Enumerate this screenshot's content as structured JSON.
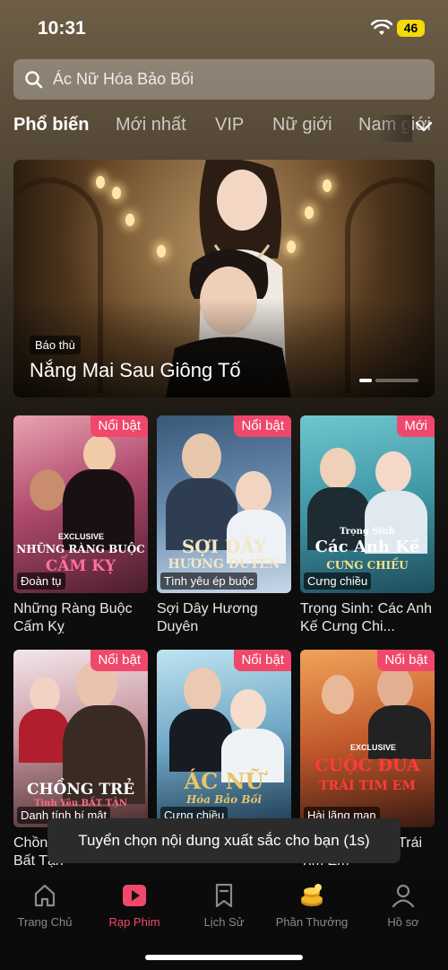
{
  "status": {
    "time": "10:31",
    "battery": "46"
  },
  "search": {
    "placeholder": "Ác Nữ Hóa Bảo Bối"
  },
  "tabs": [
    {
      "label": "Phổ biến",
      "active": true
    },
    {
      "label": "Mới nhất"
    },
    {
      "label": "VIP"
    },
    {
      "label": "Nữ giới"
    },
    {
      "label": "Nam giới"
    }
  ],
  "hero": {
    "tag": "Báo thù",
    "title": "Nắng Mai Sau Giông Tố"
  },
  "cards": [
    {
      "badge": "Nổi bật",
      "genre": "Đoàn tụ",
      "title": "Những Ràng Buộc Cấm Kỵ",
      "art_top": "EXCLUSIVE",
      "art_title": "NHỮNG RÀNG BUỘC",
      "art_sub": "CẤM KỴ"
    },
    {
      "badge": "Nổi bật",
      "genre": "Tình yêu ép buộc",
      "title": "Sợi Dây Hương Duyên",
      "art_title": "SỢI DÂY",
      "art_sub": "HƯƠNG DUYÊN"
    },
    {
      "badge": "Mới",
      "genre": "Cưng chiều",
      "title": "Trọng Sinh: Các Anh Kế Cưng Chi...",
      "art_top": "Trọng Sinh",
      "art_title": "Các Anh Kế",
      "art_sub": "CƯNG CHIỀU"
    },
    {
      "badge": "Nổi bật",
      "genre": "Danh tính bí mật",
      "title": "Chồng Trẻ Tình Yêu Bất Tận",
      "art_title": "CHỒNG TRẺ",
      "art_sub": "Tình Yêu BẤT TẬN"
    },
    {
      "badge": "Nổi bật",
      "genre": "Cưng chiều",
      "title": "Ác Nữ Hóa Bảo Bối",
      "art_title": "ÁC NỮ",
      "art_sub": "Hóa Bảo Bối"
    },
    {
      "badge": "Nổi bật",
      "genre": "Hài lãng mạn",
      "title": "Cuộc Đua Đến Trái Tim Em",
      "art_top": "EXCLUSIVE",
      "art_title": "CUỘC ĐUA",
      "art_sub": "TRÁI TIM EM"
    }
  ],
  "toast": "Tuyển chọn nội dung xuất sắc cho bạn (1s)",
  "nav": [
    {
      "label": "Trang Chủ",
      "icon": "home-icon"
    },
    {
      "label": "Rạp Phim",
      "icon": "play-icon",
      "active": true
    },
    {
      "label": "Lịch Sử",
      "icon": "bookmark-icon"
    },
    {
      "label": "Phần Thưởng",
      "icon": "coins-icon"
    },
    {
      "label": "Hồ sơ",
      "icon": "profile-icon"
    }
  ],
  "colors": {
    "accent": "#f0486b",
    "battery": "#f5d90a"
  }
}
